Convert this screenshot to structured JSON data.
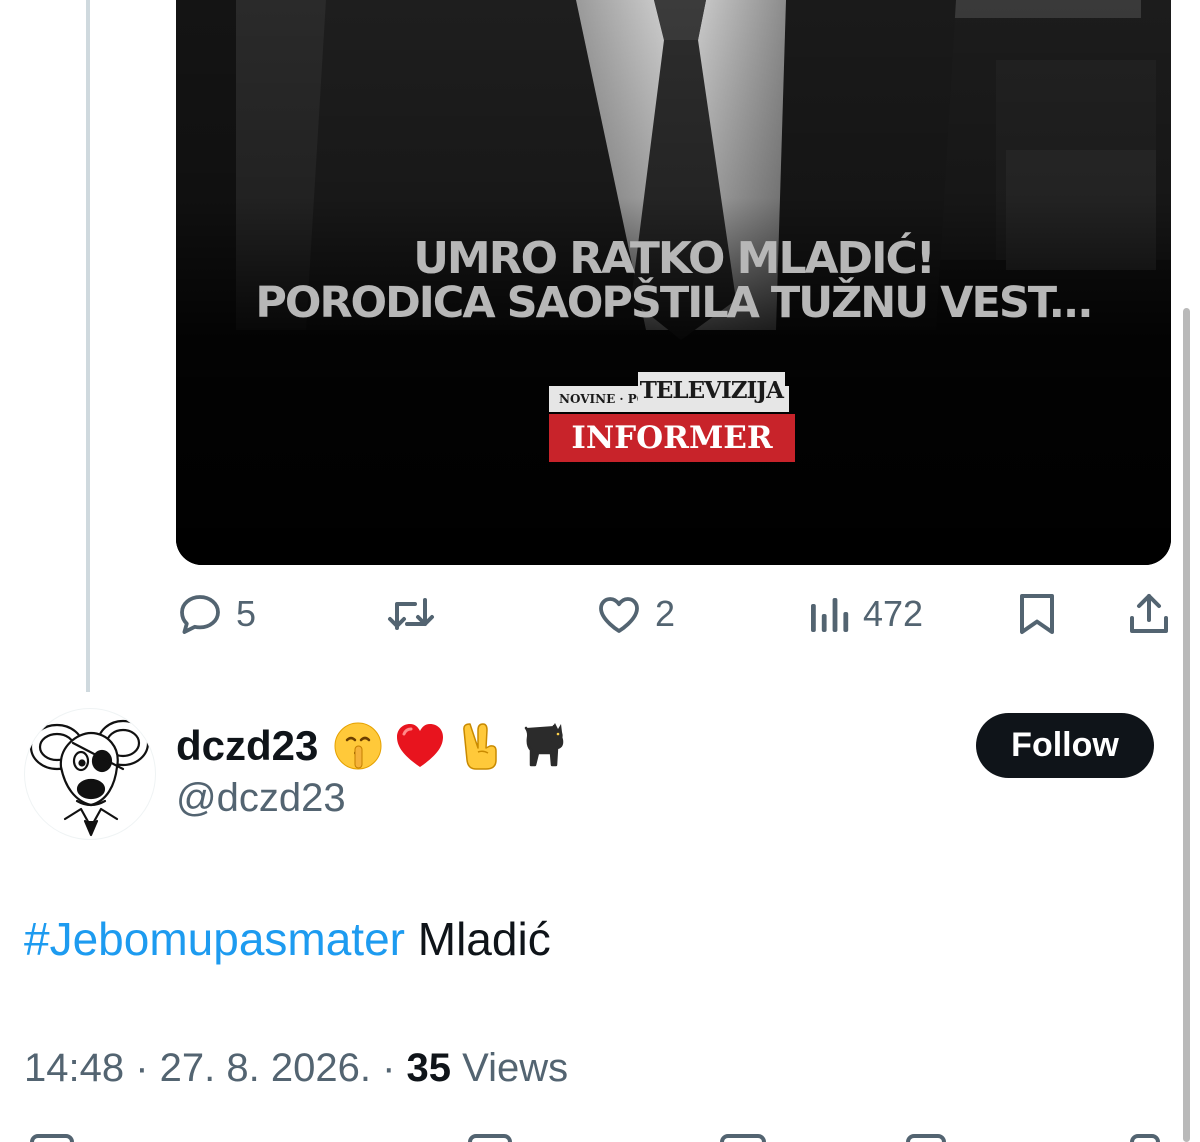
{
  "media": {
    "headline_line1": "UMRO RATKO MLADIĆ!",
    "headline_line2": "PORODICA SAOPŠTILA TUŽNU VEST...",
    "brand_top": "NOVINE · PORTAL ·",
    "brand_top_tv": "TELEVIZIJA",
    "brand_name": "INFORMER"
  },
  "actions": {
    "reply_count": "5",
    "retweet_count": "",
    "like_count": "2",
    "views_count": "472"
  },
  "user": {
    "display_name": "dczd23",
    "emojis": [
      "shushing-face-emoji",
      "red-heart-emoji",
      "victory-hand-emoji",
      "black-cat-emoji"
    ],
    "handle": "@dczd23"
  },
  "follow_label": "Follow",
  "tweet": {
    "hashtag": "#Jebomupasmater",
    "text": " Mladić"
  },
  "meta": {
    "time": "14:48",
    "separator1": " · ",
    "date": "27. 8. 2026.",
    "separator2": " · ",
    "views_count": "35",
    "views_label": " Views"
  },
  "colors": {
    "accent": "#1d9bf0",
    "text": "#0f1419",
    "secondary": "#536471",
    "brand_red": "#c8232a"
  }
}
